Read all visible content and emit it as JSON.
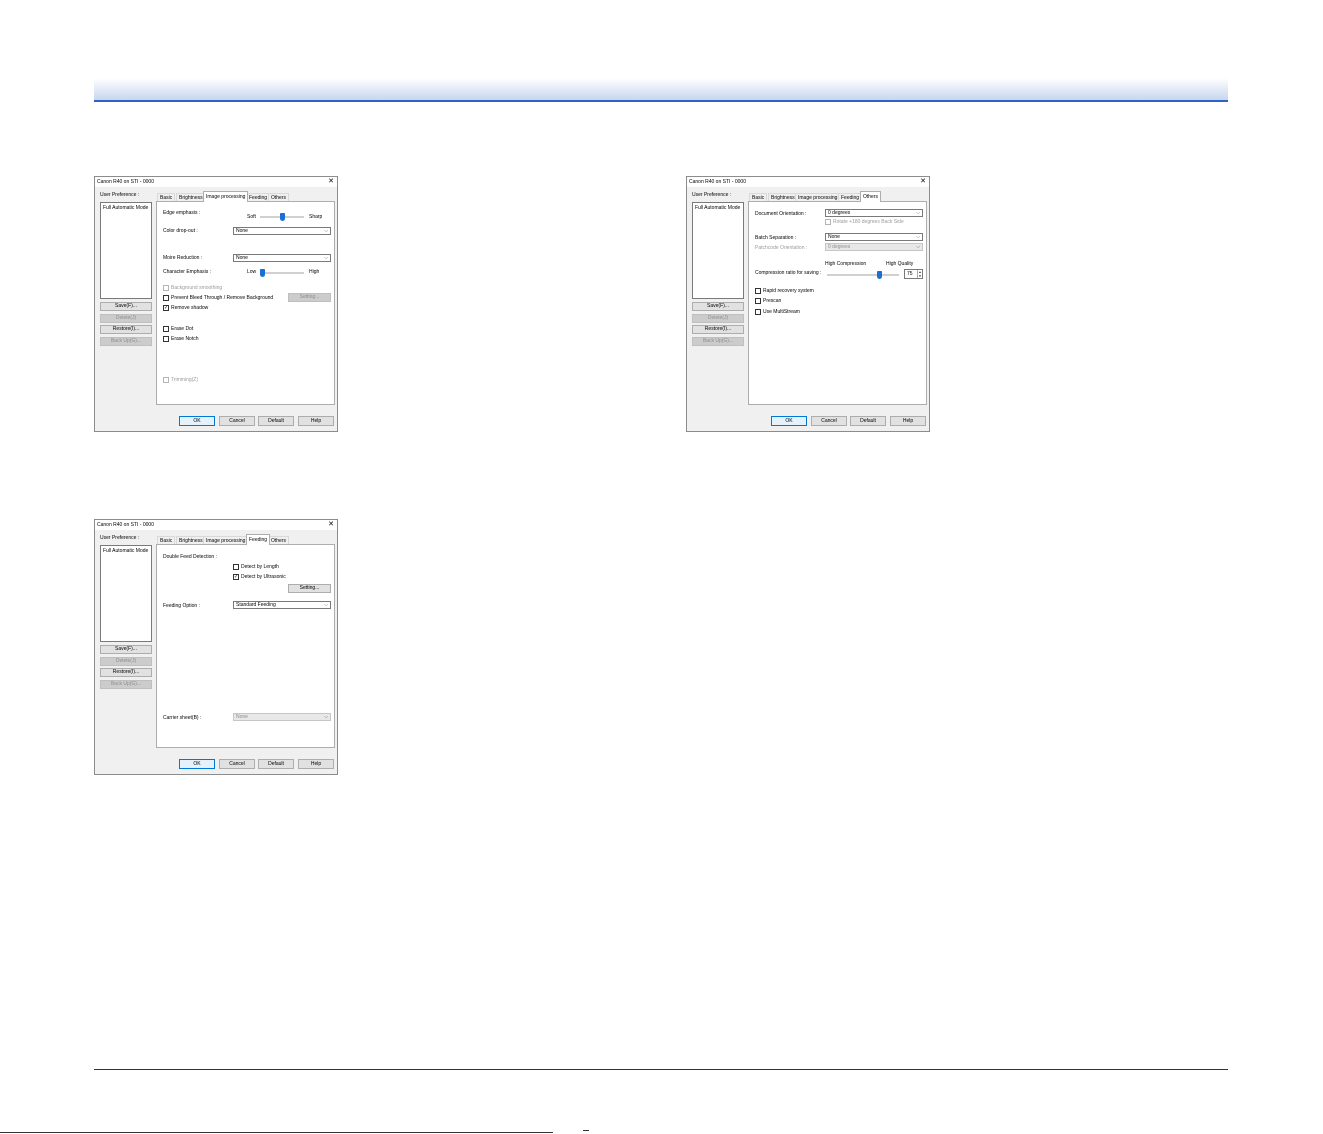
{
  "dialog_title": "Canon R40 on STI - 0000",
  "sidebar": {
    "label": "User Preference :",
    "list_item": "Full Automatic Mode",
    "buttons": [
      "Save(F)...",
      "Delete(J)",
      "Restore(I)...",
      "Back Up(G)..."
    ]
  },
  "tabs": [
    "Basic",
    "Brightness",
    "Image processing",
    "Feeding",
    "Others"
  ],
  "footer_buttons": {
    "ok": "OK",
    "cancel": "Cancel",
    "default": "Default",
    "help": "Help"
  },
  "image_processing": {
    "edge_emphasis": "Edge emphasis :",
    "soft": "Soft",
    "sharp": "Sharp",
    "edge_emphasis_level": 0.5,
    "color_drop_out": "Color drop-out :",
    "color_drop_out_value": "None",
    "moire_reduction": "Moire Reduction :",
    "moire_value": "None",
    "character_emphasis": "Character Emphasis :",
    "low": "Low",
    "high": "High",
    "character_emphasis_level": 0.0,
    "background_smoothing": "Background smoothing",
    "prevent_bleed": "Prevent Bleed Through / Remove Background",
    "setting_button": "Setting...",
    "remove_shadow": "Remove shadow",
    "erase_dot": "Erase Dot",
    "erase_notch": "Erase Notch",
    "trimming": "Trimming(Z)"
  },
  "others": {
    "document_orientation": "Document Orientation :",
    "document_orientation_value": "0 degrees",
    "rotate_back_side": "Rotate +180 degrees Back Side",
    "batch_separation": "Batch Separation :",
    "batch_separation_value": "None",
    "patchcode_orientation": "Patchcode Orientation :",
    "patchcode_orientation_value": "0 degrees",
    "high_compression": "High Compression",
    "high_quality": "High Quality",
    "compression_ratio": "Compression ratio for saving :",
    "compression_value": "75",
    "compression_level": 0.75,
    "rapid_recovery": "Rapid recovery system",
    "prescan": "Prescan",
    "use_multistream": "Use MultiStream"
  },
  "feeding": {
    "double_feed_detection": "Double Feed Detection :",
    "detect_by_length": "Detect by Length",
    "detect_by_ultrasonic": "Detect by Ultrasonic",
    "setting_button": "Setting...",
    "feeding_option": "Feeding Option :",
    "feeding_option_value": "Standard Feeding",
    "carrier_sheet": "Carrier sheet(B) :",
    "carrier_sheet_value": "None"
  },
  "colors": {
    "accent": "#2c63c4",
    "slider_thumb": "#1a6fd6"
  }
}
